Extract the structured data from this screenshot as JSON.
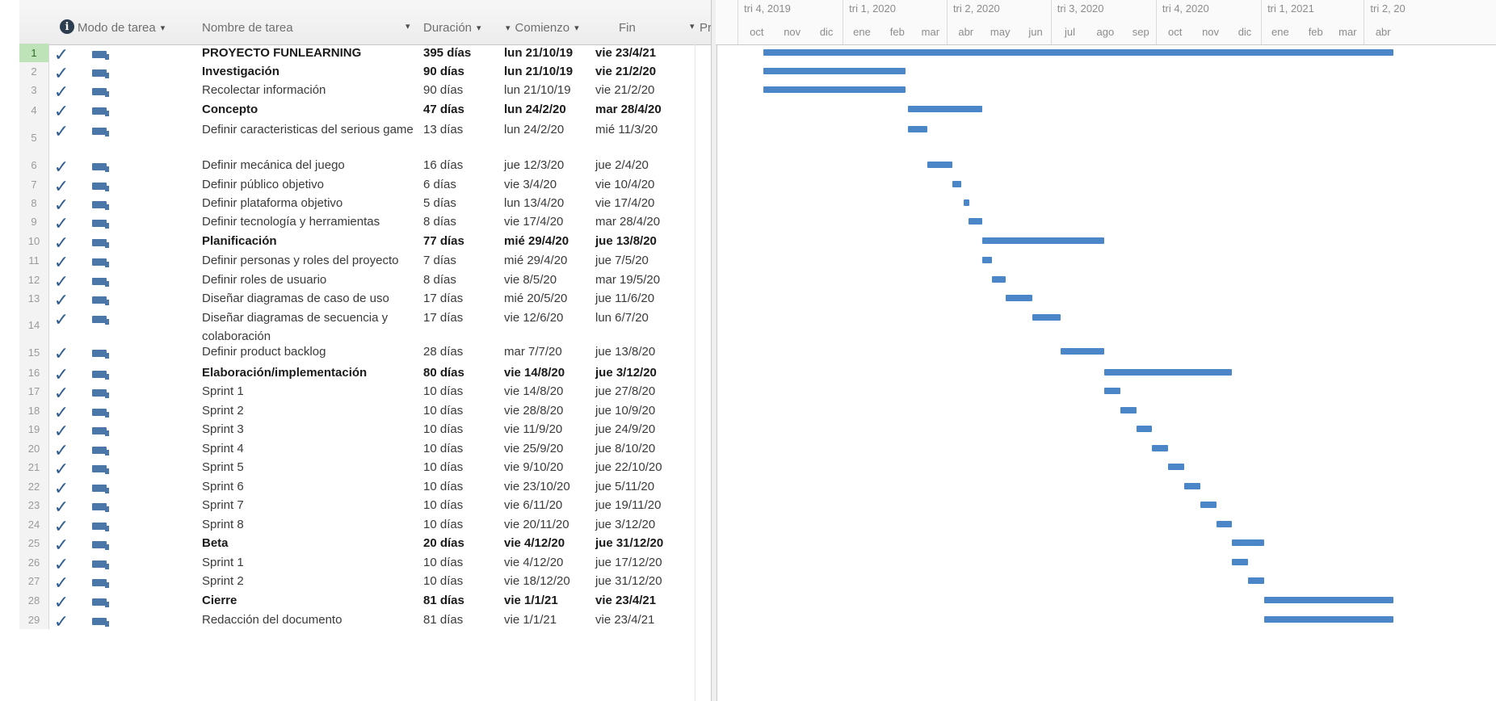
{
  "headers": {
    "mode": "Modo de tarea",
    "name": "Nombre de tarea",
    "duration": "Duración",
    "start": "Comienzo",
    "end": "Fin",
    "pred": "Prede",
    "info_glyph": "i"
  },
  "timescale": {
    "quarters": [
      "tri 4, 2019",
      "tri 1, 2020",
      "tri 2, 2020",
      "tri 3, 2020",
      "tri 4, 2020",
      "tri 1, 2021",
      "tri 2, 20"
    ],
    "months": [
      "oct",
      "nov",
      "dic",
      "ene",
      "feb",
      "mar",
      "abr",
      "may",
      "jun",
      "jul",
      "ago",
      "sep",
      "oct",
      "nov",
      "dic",
      "ene",
      "feb",
      "mar",
      "abr"
    ]
  },
  "tasks": [
    {
      "num": "1",
      "name": "PROYECTO FUNLEARNING",
      "duration": "395 días",
      "start": "lun 21/10/19",
      "end": "vie 23/4/21",
      "bold": true,
      "bar": [
        "2019-10-21",
        "2021-04-23"
      ]
    },
    {
      "num": "2",
      "name": "Investigación",
      "duration": "90 días",
      "start": "lun 21/10/19",
      "end": "vie 21/2/20",
      "bold": true,
      "bar": [
        "2019-10-21",
        "2020-02-21"
      ]
    },
    {
      "num": "3",
      "name": "Recolectar información",
      "duration": "90 días",
      "start": "lun 21/10/19",
      "end": "vie 21/2/20",
      "bold": false,
      "bar": [
        "2019-10-21",
        "2020-02-21"
      ]
    },
    {
      "num": "4",
      "name": "Concepto",
      "duration": "47 días",
      "start": "lun 24/2/20",
      "end": "mar 28/4/20",
      "bold": true,
      "bar": [
        "2020-02-24",
        "2020-04-28"
      ]
    },
    {
      "num": "5",
      "name": "Definir caracteristicas del serious game",
      "duration": "13 días",
      "start": "lun 24/2/20",
      "end": "mié 11/3/20",
      "bold": false,
      "bar": [
        "2020-02-24",
        "2020-03-11"
      ]
    },
    {
      "num": "6",
      "name": "Definir mecánica del juego",
      "duration": "16 días",
      "start": "jue 12/3/20",
      "end": "jue 2/4/20",
      "bold": false,
      "bar": [
        "2020-03-12",
        "2020-04-02"
      ]
    },
    {
      "num": "7",
      "name": "Definir público objetivo",
      "duration": "6 días",
      "start": "vie 3/4/20",
      "end": "vie 10/4/20",
      "bold": false,
      "bar": [
        "2020-04-03",
        "2020-04-10"
      ]
    },
    {
      "num": "8",
      "name": "Definir plataforma objetivo",
      "duration": "5 días",
      "start": "lun 13/4/20",
      "end": "vie 17/4/20",
      "bold": false,
      "bar": [
        "2020-04-13",
        "2020-04-17"
      ]
    },
    {
      "num": "9",
      "name": "Definir tecnología y herramientas",
      "duration": "8 días",
      "start": "vie 17/4/20",
      "end": "mar 28/4/20",
      "bold": false,
      "bar": [
        "2020-04-17",
        "2020-04-28"
      ]
    },
    {
      "num": "10",
      "name": "Planificación",
      "duration": "77 días",
      "start": "mié 29/4/20",
      "end": "jue 13/8/20",
      "bold": true,
      "bar": [
        "2020-04-29",
        "2020-08-13"
      ]
    },
    {
      "num": "11",
      "name": "Definir personas y roles del proyecto",
      "duration": "7 días",
      "start": "mié 29/4/20",
      "end": "jue 7/5/20",
      "bold": false,
      "bar": [
        "2020-04-29",
        "2020-05-07"
      ]
    },
    {
      "num": "12",
      "name": "Definir roles de usuario",
      "duration": "8 días",
      "start": "vie 8/5/20",
      "end": "mar 19/5/20",
      "bold": false,
      "bar": [
        "2020-05-08",
        "2020-05-19"
      ]
    },
    {
      "num": "13",
      "name": "Diseñar diagramas de caso de uso",
      "duration": "17 días",
      "start": "mié 20/5/20",
      "end": "jue 11/6/20",
      "bold": false,
      "bar": [
        "2020-05-20",
        "2020-06-11"
      ]
    },
    {
      "num": "14",
      "name": "Diseñar diagramas de secuencia y colaboración",
      "duration": "17 días",
      "start": "vie 12/6/20",
      "end": "lun 6/7/20",
      "bold": false,
      "bar": [
        "2020-06-12",
        "2020-07-06"
      ]
    },
    {
      "num": "15",
      "name": "Definir product backlog",
      "duration": "28 días",
      "start": "mar 7/7/20",
      "end": "jue 13/8/20",
      "bold": false,
      "bar": [
        "2020-07-07",
        "2020-08-13"
      ]
    },
    {
      "num": "16",
      "name": "Elaboración/implementación",
      "duration": "80 días",
      "start": "vie 14/8/20",
      "end": "jue 3/12/20",
      "bold": true,
      "bar": [
        "2020-08-14",
        "2020-12-03"
      ]
    },
    {
      "num": "17",
      "name": "Sprint 1",
      "duration": "10 días",
      "start": "vie 14/8/20",
      "end": "jue 27/8/20",
      "bold": false,
      "bar": [
        "2020-08-14",
        "2020-08-27"
      ]
    },
    {
      "num": "18",
      "name": "Sprint 2",
      "duration": "10 días",
      "start": "vie 28/8/20",
      "end": "jue 10/9/20",
      "bold": false,
      "bar": [
        "2020-08-28",
        "2020-09-10"
      ]
    },
    {
      "num": "19",
      "name": "Sprint 3",
      "duration": "10 días",
      "start": "vie 11/9/20",
      "end": "jue 24/9/20",
      "bold": false,
      "bar": [
        "2020-09-11",
        "2020-09-24"
      ]
    },
    {
      "num": "20",
      "name": "Sprint 4",
      "duration": "10 días",
      "start": "vie 25/9/20",
      "end": "jue 8/10/20",
      "bold": false,
      "bar": [
        "2020-09-25",
        "2020-10-08"
      ]
    },
    {
      "num": "21",
      "name": "Sprint 5",
      "duration": "10 días",
      "start": "vie 9/10/20",
      "end": "jue 22/10/20",
      "bold": false,
      "bar": [
        "2020-10-09",
        "2020-10-22"
      ]
    },
    {
      "num": "22",
      "name": "Sprint 6",
      "duration": "10 días",
      "start": "vie 23/10/20",
      "end": "jue 5/11/20",
      "bold": false,
      "bar": [
        "2020-10-23",
        "2020-11-05"
      ]
    },
    {
      "num": "23",
      "name": "Sprint 7",
      "duration": "10 días",
      "start": "vie 6/11/20",
      "end": "jue 19/11/20",
      "bold": false,
      "bar": [
        "2020-11-06",
        "2020-11-19"
      ]
    },
    {
      "num": "24",
      "name": "Sprint 8",
      "duration": "10 días",
      "start": "vie 20/11/20",
      "end": "jue 3/12/20",
      "bold": false,
      "bar": [
        "2020-11-20",
        "2020-12-03"
      ]
    },
    {
      "num": "25",
      "name": "Beta",
      "duration": "20 días",
      "start": "vie 4/12/20",
      "end": "jue 31/12/20",
      "bold": true,
      "bar": [
        "2020-12-04",
        "2020-12-31"
      ]
    },
    {
      "num": "26",
      "name": "Sprint 1",
      "duration": "10 días",
      "start": "vie 4/12/20",
      "end": "jue 17/12/20",
      "bold": false,
      "bar": [
        "2020-12-04",
        "2020-12-17"
      ]
    },
    {
      "num": "27",
      "name": "Sprint 2",
      "duration": "10 días",
      "start": "vie 18/12/20",
      "end": "jue 31/12/20",
      "bold": false,
      "bar": [
        "2020-12-18",
        "2020-12-31"
      ]
    },
    {
      "num": "28",
      "name": "Cierre",
      "duration": "81 días",
      "start": "vie 1/1/21",
      "end": "vie 23/4/21",
      "bold": true,
      "bar": [
        "2021-01-01",
        "2021-04-23"
      ]
    },
    {
      "num": "29",
      "name": "Redacción del documento",
      "duration": "81 días",
      "start": "vie 1/1/21",
      "end": "vie 23/4/21",
      "bold": false,
      "bar": [
        "2021-01-01",
        "2021-04-23"
      ]
    }
  ],
  "colors": {
    "bar": "#4a86c8",
    "check": "#2f5d8f",
    "selected_row": "#bfe3b8"
  },
  "icons": {
    "complete": "checkmark-icon",
    "mode": "auto-schedule-icon",
    "info": "info-icon"
  }
}
